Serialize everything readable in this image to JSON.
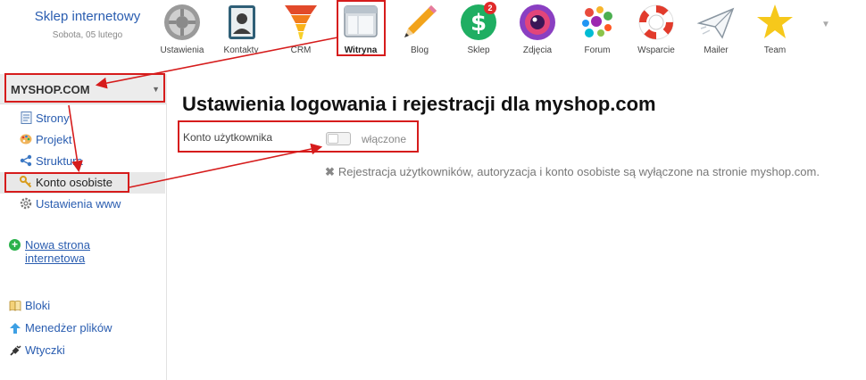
{
  "brand": {
    "title": "Sklep internetowy",
    "date": "Sobota, 05 lutego"
  },
  "apps": [
    {
      "label": "Ustawienia",
      "icon": "gear-icon"
    },
    {
      "label": "Kontakty",
      "icon": "contacts-book-icon"
    },
    {
      "label": "CRM",
      "icon": "funnel-icon"
    },
    {
      "label": "Witryna",
      "icon": "website-window-icon",
      "active": true
    },
    {
      "label": "Blog",
      "icon": "pencil-icon"
    },
    {
      "label": "Sklep",
      "icon": "dollar-icon",
      "badge": "2"
    },
    {
      "label": "Zdjęcia",
      "icon": "camera-lens-icon"
    },
    {
      "label": "Forum",
      "icon": "colorful-dots-icon"
    },
    {
      "label": "Wsparcie",
      "icon": "lifebuoy-icon"
    },
    {
      "label": "Mailer",
      "icon": "paper-plane-icon"
    },
    {
      "label": "Team",
      "icon": "star-person-icon"
    }
  ],
  "sidebar": {
    "site_name": "MYSHOP.COM",
    "items": [
      {
        "label": "Strony",
        "icon": "page-icon"
      },
      {
        "label": "Projekt",
        "icon": "palette-icon"
      },
      {
        "label": "Struktura",
        "icon": "share-icon"
      },
      {
        "label": "Konto osobiste",
        "icon": "key-icon",
        "active": true
      },
      {
        "label": "Ustawienia www",
        "icon": "gear-icon"
      }
    ],
    "new_site": "Nowa strona internetowa",
    "links": [
      {
        "label": "Bloki",
        "icon": "book-icon"
      },
      {
        "label": "Menedżer plików",
        "icon": "upload-arrow-icon"
      },
      {
        "label": "Wtyczki",
        "icon": "plug-icon"
      }
    ]
  },
  "main": {
    "title": "Ustawienia logowania i rejestracji dla myshop.com",
    "field_label": "Konto użytkownika",
    "toggle_state": "włączone",
    "toggle_on": false,
    "notice": "Rejestracja użytkowników, autoryzacja i konto osobiste są wyłączone na stronie myshop.com."
  },
  "colors": {
    "link": "#2a5db0",
    "annotation": "#d61c1c",
    "badge": "#e02a2a"
  }
}
